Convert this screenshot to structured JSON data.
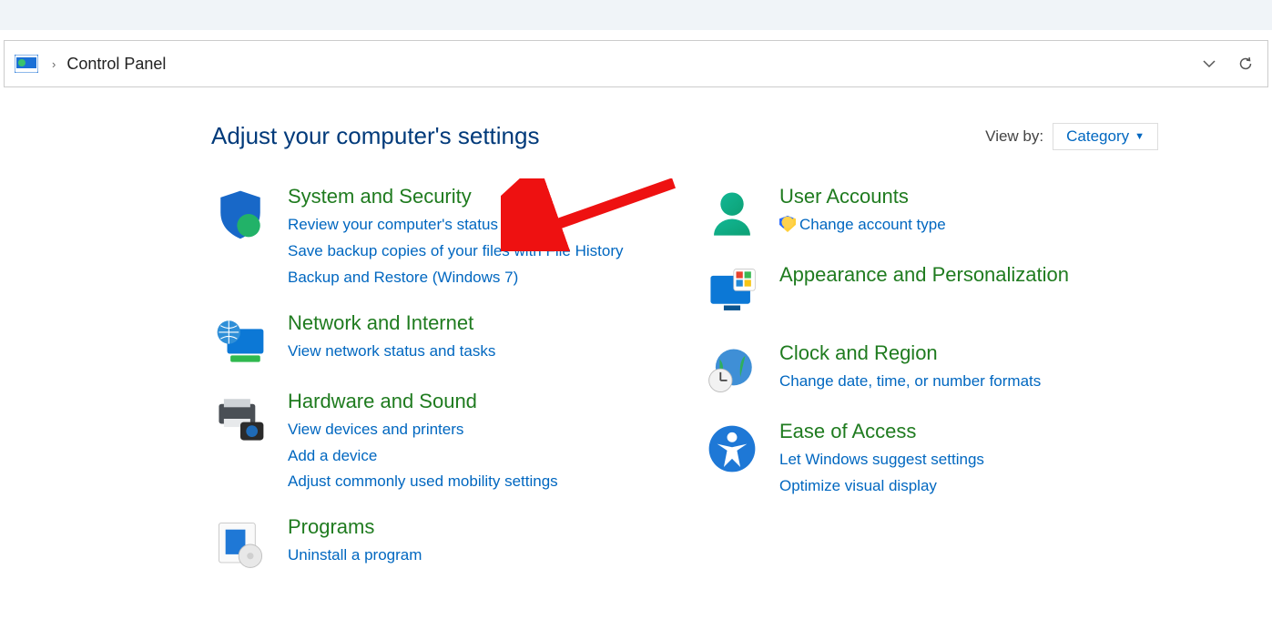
{
  "address_bar": {
    "location": "Control Panel"
  },
  "page": {
    "heading": "Adjust your computer's settings",
    "viewby_label": "View by:",
    "viewby_value": "Category"
  },
  "left": [
    {
      "id": "system-security",
      "title": "System and Security",
      "links": [
        "Review your computer's status",
        "Save backup copies of your files with File History",
        "Backup and Restore (Windows 7)"
      ]
    },
    {
      "id": "network-internet",
      "title": "Network and Internet",
      "links": [
        "View network status and tasks"
      ]
    },
    {
      "id": "hardware-sound",
      "title": "Hardware and Sound",
      "links": [
        "View devices and printers",
        "Add a device",
        "Adjust commonly used mobility settings"
      ]
    },
    {
      "id": "programs",
      "title": "Programs",
      "links": [
        "Uninstall a program"
      ]
    }
  ],
  "right": [
    {
      "id": "user-accounts",
      "title": "User Accounts",
      "links": [
        {
          "text": "Change account type",
          "shield": true
        }
      ]
    },
    {
      "id": "appearance-personalization",
      "title": "Appearance and Personalization",
      "links": []
    },
    {
      "id": "clock-region",
      "title": "Clock and Region",
      "links": [
        "Change date, time, or number formats"
      ]
    },
    {
      "id": "ease-of-access",
      "title": "Ease of Access",
      "links": [
        "Let Windows suggest settings",
        "Optimize visual display"
      ]
    }
  ]
}
